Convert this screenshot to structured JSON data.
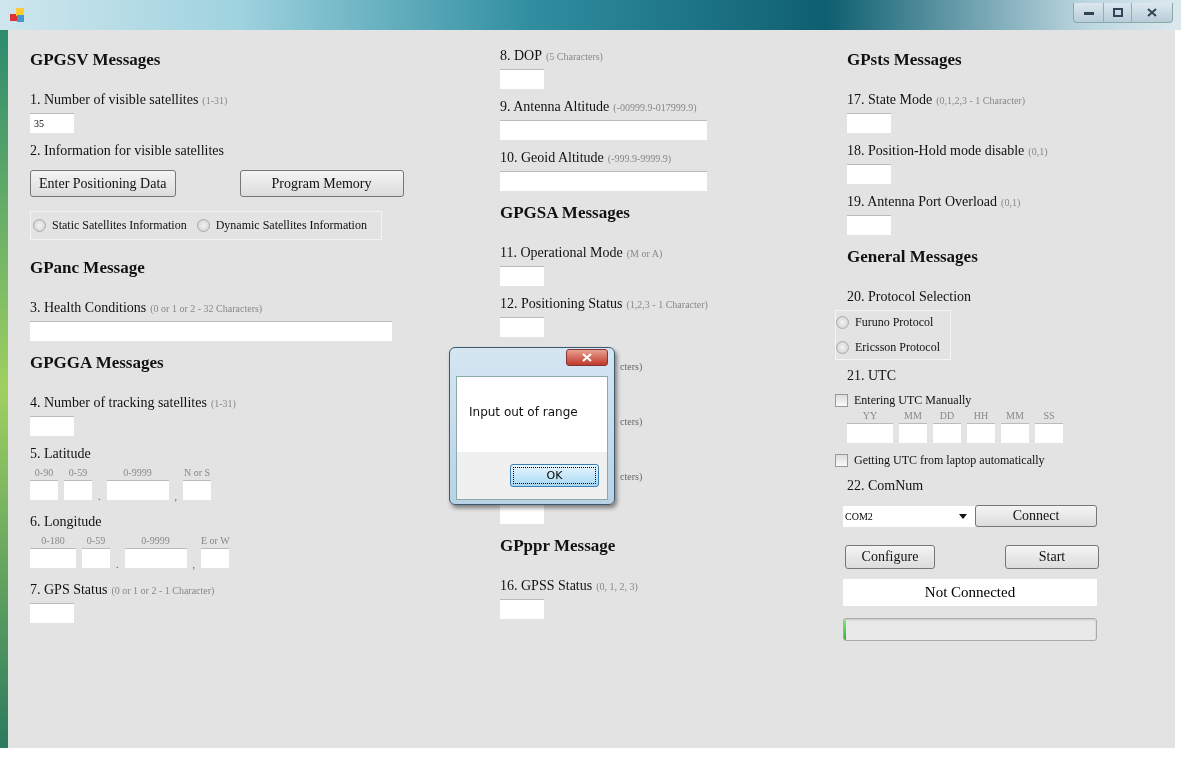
{
  "columns": [
    {
      "items": [
        {
          "kind": "heading",
          "text": "GPGSV Messages"
        },
        {
          "kind": "label",
          "text": "1. Number of visible satellites",
          "hint": "(1-31)"
        },
        {
          "kind": "input",
          "value": "35"
        },
        {
          "kind": "label",
          "text": "2. Information for visible satellites"
        },
        {
          "kind": "buttons",
          "buttons": [
            "Enter Positioning Data",
            "Program Memory"
          ]
        },
        {
          "kind": "radios",
          "options": [
            {
              "label": "Static Satellites Information",
              "selected": false
            },
            {
              "label": "Dynamic Satellites Information",
              "selected": false
            }
          ]
        },
        {
          "kind": "heading",
          "text": "GPanc Message"
        },
        {
          "kind": "label",
          "text": "3. Health Conditions",
          "hint": "(0 or 1 or 2 - 32 Characters)"
        },
        {
          "kind": "input"
        },
        {
          "kind": "heading",
          "text": "GPGGA Messages"
        },
        {
          "kind": "label",
          "text": "4. Number of tracking satellites",
          "hint": "(1-31)"
        },
        {
          "kind": "input"
        },
        {
          "kind": "label",
          "text": "5. Latitude"
        },
        {
          "kind": "coord",
          "parts": [
            {
              "hint": "0-90"
            },
            {
              "hint": "0-59"
            },
            {
              "hint": "0-9999",
              "sep": "."
            },
            {
              "hint": "N or S",
              "sep": ","
            }
          ]
        },
        {
          "kind": "label",
          "text": "6. Longitude"
        },
        {
          "kind": "coord",
          "parts": [
            {
              "hint": "0-180"
            },
            {
              "hint": "0-59"
            },
            {
              "hint": "0-9999",
              "sep": "."
            },
            {
              "hint": "E or W",
              "sep": ","
            }
          ]
        },
        {
          "kind": "label",
          "text": "7. GPS Status",
          "hint": "(0 or 1 or 2 - 1 Character)"
        },
        {
          "kind": "input"
        }
      ]
    },
    {
      "items": [
        {
          "kind": "label",
          "text": "8. DOP",
          "hint": "(5 Characters)"
        },
        {
          "kind": "input"
        },
        {
          "kind": "label",
          "text": "9. Antenna Altitude",
          "hint": "(-00999.9-017999.9)"
        },
        {
          "kind": "input"
        },
        {
          "kind": "label",
          "text": "10. Geoid Altitude",
          "hint": "(-999.9-9999.9)"
        },
        {
          "kind": "input"
        },
        {
          "kind": "heading",
          "text": "GPGSA Messages"
        },
        {
          "kind": "label",
          "text": "11. Operational Mode",
          "hint": "(M or A)"
        },
        {
          "kind": "input"
        },
        {
          "kind": "label",
          "text": "12. Positioning Status",
          "hint": "(1,2,3 - 1 Character)"
        },
        {
          "kind": "input"
        },
        {
          "kind": "partial",
          "hint": "cters)"
        },
        {
          "kind": "partial",
          "hint": "cters)"
        },
        {
          "kind": "partial",
          "hint": "cters)"
        },
        {
          "kind": "input"
        },
        {
          "kind": "heading",
          "text": "GPppr Message"
        },
        {
          "kind": "label",
          "text": "16. GPSS Status",
          "hint": "(0, 1, 2, 3)"
        },
        {
          "kind": "input"
        }
      ]
    },
    {
      "items": [
        {
          "kind": "heading",
          "text": "GPsts Messages"
        },
        {
          "kind": "label",
          "text": "17. State Mode",
          "hint": "(0,1,2,3 - 1 Character)"
        },
        {
          "kind": "input"
        },
        {
          "kind": "label",
          "text": "18. Position-Hold mode disable",
          "hint": "(0,1)"
        },
        {
          "kind": "input"
        },
        {
          "kind": "label",
          "text": "19. Antenna Port Overload",
          "hint": "(0,1)"
        },
        {
          "kind": "input"
        },
        {
          "kind": "heading",
          "text": "General Messages"
        },
        {
          "kind": "label",
          "text": "20. Protocol Selection"
        },
        {
          "kind": "radiostack",
          "options": [
            {
              "label": "Furuno Protocol",
              "selected": false
            },
            {
              "label": "Ericsson Protocol",
              "selected": false
            }
          ]
        },
        {
          "kind": "label",
          "text": "21. UTC"
        },
        {
          "kind": "checkbox",
          "label": "Entering UTC Manually",
          "checked": false
        },
        {
          "kind": "coord",
          "parts": [
            {
              "hint": "YY"
            },
            {
              "hint": "MM"
            },
            {
              "hint": "DD"
            },
            {
              "hint": "HH"
            },
            {
              "hint": "MM"
            },
            {
              "hint": "SS"
            }
          ]
        },
        {
          "kind": "checkbox",
          "label": "Getting UTC from laptop automatically",
          "checked": false
        },
        {
          "kind": "label",
          "text": "22. ComNum"
        },
        {
          "kind": "combo",
          "value": "COM2",
          "button": "Connect"
        },
        {
          "kind": "pair",
          "buttons": [
            "Configure",
            "Start"
          ]
        },
        {
          "kind": "status",
          "text": "Not Connected"
        },
        {
          "kind": "progress",
          "level": 0
        }
      ]
    }
  ],
  "dialog": {
    "message": "Input out of range",
    "button": "OK"
  }
}
